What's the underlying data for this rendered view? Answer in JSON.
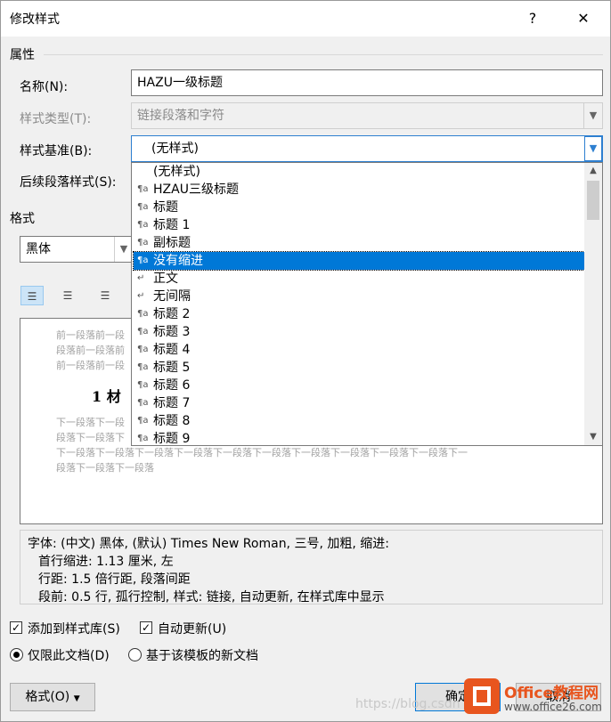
{
  "title": "修改样式",
  "help": "?",
  "close": "✕",
  "sections": {
    "properties": "属性",
    "format": "格式"
  },
  "fields": {
    "name_label": "名称(N):",
    "name_value": "HAZU一级标题",
    "style_type_label": "样式类型(T):",
    "style_type_value": "链接段落和字符",
    "based_on_label": "样式基准(B):",
    "based_on_value": "(无样式)",
    "following_label": "后续段落样式(S):"
  },
  "font": {
    "name": "黑体"
  },
  "dropdown": {
    "items": [
      {
        "icon": "",
        "label": "(无样式)"
      },
      {
        "icon": "¶a",
        "label": "HZAU三级标题"
      },
      {
        "icon": "¶a",
        "label": "标题"
      },
      {
        "icon": "¶a",
        "label": "标题 1"
      },
      {
        "icon": "¶a",
        "label": "副标题"
      },
      {
        "icon": "¶a",
        "label": "没有缩进"
      },
      {
        "icon": "↵",
        "label": "正文"
      },
      {
        "icon": "↵",
        "label": "无间隔"
      },
      {
        "icon": "¶a",
        "label": "标题 2"
      },
      {
        "icon": "¶a",
        "label": "标题 3"
      },
      {
        "icon": "¶a",
        "label": "标题 4"
      },
      {
        "icon": "¶a",
        "label": "标题 5"
      },
      {
        "icon": "¶a",
        "label": "标题 6"
      },
      {
        "icon": "¶a",
        "label": "标题 7"
      },
      {
        "icon": "¶a",
        "label": "标题 8"
      },
      {
        "icon": "¶a",
        "label": "标题 9"
      }
    ],
    "selected_index": 5
  },
  "preview": {
    "prev_lines": [
      "前一段落前一段",
      "段落前一段落前",
      "前一段落前一段"
    ],
    "heading": "1 材",
    "next_lines": [
      "下一段落下一段",
      "段落下一段落下",
      "下一段落下一段落下一段落下一段落下一段落下一段落下一段落下一段落下一段落下一段落下一",
      "段落下一段落下一段落"
    ]
  },
  "description": {
    "line1": "字体: (中文) 黑体, (默认) Times New Roman, 三号, 加粗, 缩进:",
    "line2": "首行缩进:  1.13 厘米, 左",
    "line3": "行距: 1.5 倍行距, 段落间距",
    "line4": "段前: 0.5 行, 孤行控制, 样式: 链接, 自动更新, 在样式库中显示"
  },
  "options": {
    "add_to_gallery": "添加到样式库(S)",
    "auto_update": "自动更新(U)",
    "only_this_doc": "仅限此文档(D)",
    "new_docs_template": "基于该模板的新文档"
  },
  "buttons": {
    "format": "格式(O)",
    "ok": "确定",
    "cancel": "取消"
  },
  "watermark": {
    "url": "https://blog.csdn",
    "brand": "Office教程网",
    "site": "www.office26.com"
  }
}
